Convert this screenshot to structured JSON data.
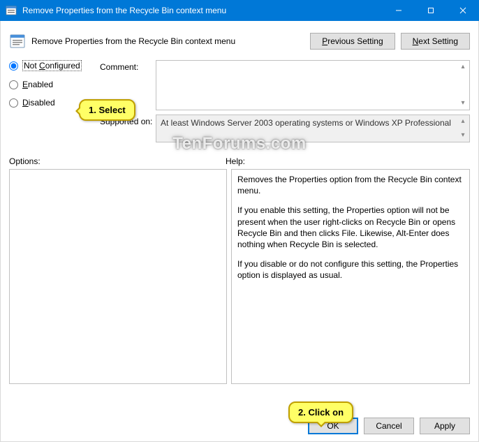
{
  "window": {
    "title": "Remove Properties from the Recycle Bin context menu"
  },
  "header": {
    "title": "Remove Properties from the Recycle Bin context menu",
    "prev_btn": "Previous Setting",
    "prev_u": "P",
    "next_btn": "Next Setting",
    "next_u": "N"
  },
  "radios": {
    "not_configured": "Not Configured",
    "not_configured_u": "C",
    "enabled": "Enabled",
    "enabled_u": "E",
    "disabled": "Disabled",
    "disabled_u": "D"
  },
  "labels": {
    "comment": "Comment:",
    "supported": "Supported on:",
    "options": "Options:",
    "help": "Help:"
  },
  "supported_text": "At least Windows Server 2003 operating systems or Windows XP Professional",
  "help": {
    "p1": "Removes the Properties option from the Recycle Bin context menu.",
    "p2": "If you enable this setting, the Properties option will not be present when the user right-clicks on Recycle Bin or opens Recycle Bin and then clicks File. Likewise, Alt-Enter does nothing when Recycle Bin is selected.",
    "p3": "If you disable or do not configure this setting, the Properties option is displayed as usual."
  },
  "buttons": {
    "ok": "OK",
    "cancel": "Cancel",
    "apply": "Apply"
  },
  "callouts": {
    "c1": "1. Select",
    "c2": "2. Click on"
  },
  "watermark": "TenForums.com"
}
